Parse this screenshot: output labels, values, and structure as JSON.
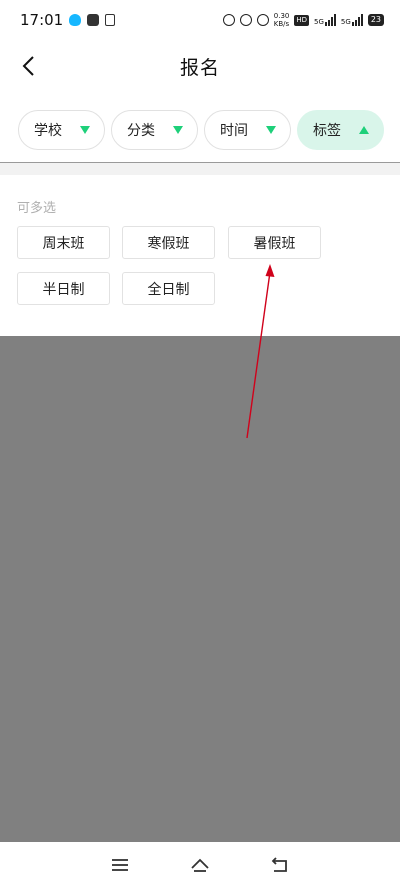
{
  "status": {
    "time": "17:01",
    "speed_top": "0.30",
    "speed_bottom": "KB/s",
    "net_a": "5G",
    "net_b": "5G",
    "battery": "23"
  },
  "header": {
    "title": "报名"
  },
  "filters": [
    {
      "label": "学校",
      "active": false
    },
    {
      "label": "分类",
      "active": false
    },
    {
      "label": "时间",
      "active": false
    },
    {
      "label": "标签",
      "active": true
    }
  ],
  "panel": {
    "hint": "可多选",
    "tags": [
      "周末班",
      "寒假班",
      "暑假班",
      "半日制",
      "全日制"
    ]
  },
  "colors": {
    "accent": "#1ed07a",
    "active_chip": "#d9f5ea",
    "overlay": "#808080",
    "annotation": "#d0021b"
  },
  "icons": [
    "back-arrow-icon",
    "triangle-down-icon",
    "triangle-up-icon",
    "menu-icon",
    "home-icon",
    "return-icon"
  ]
}
